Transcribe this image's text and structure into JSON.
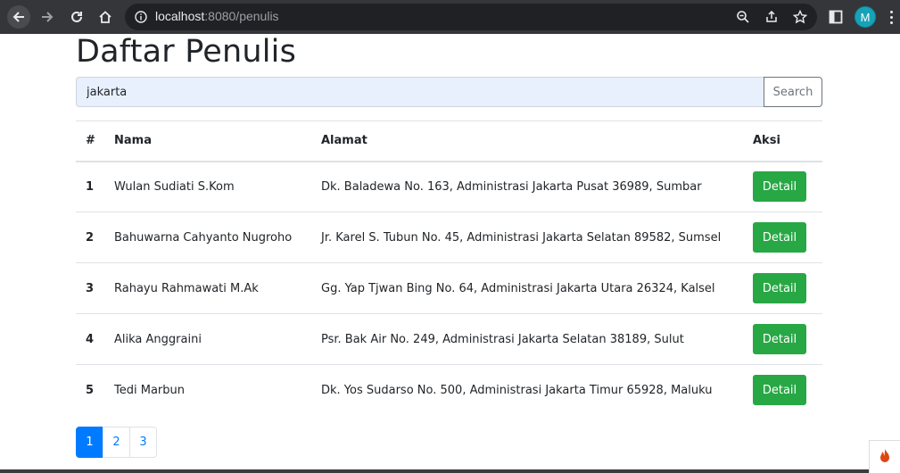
{
  "browser": {
    "url_host": "localhost",
    "url_rest": ":8080/penulis",
    "profile_initial": "M"
  },
  "page": {
    "title": "Daftar Penulis"
  },
  "search": {
    "value": "jakarta",
    "button_label": "Search"
  },
  "table": {
    "headers": [
      "#",
      "Nama",
      "Alamat",
      "Aksi"
    ],
    "rows": [
      {
        "no": "1",
        "nama": "Wulan Sudiati S.Kom",
        "alamat": "Dk. Baladewa No. 163, Administrasi Jakarta Pusat 36989, Sumbar",
        "aksi": "Detail"
      },
      {
        "no": "2",
        "nama": "Bahuwarna Cahyanto Nugroho",
        "alamat": "Jr. Karel S. Tubun No. 45, Administrasi Jakarta Selatan 89582, Sumsel",
        "aksi": "Detail"
      },
      {
        "no": "3",
        "nama": "Rahayu Rahmawati M.Ak",
        "alamat": "Gg. Yap Tjwan Bing No. 64, Administrasi Jakarta Utara 26324, Kalsel",
        "aksi": "Detail"
      },
      {
        "no": "4",
        "nama": "Alika Anggraini",
        "alamat": "Psr. Bak Air No. 249, Administrasi Jakarta Selatan 38189, Sulut",
        "aksi": "Detail"
      },
      {
        "no": "5",
        "nama": "Tedi Marbun",
        "alamat": "Dk. Yos Sudarso No. 500, Administrasi Jakarta Timur 65928, Maluku",
        "aksi": "Detail"
      }
    ]
  },
  "pagination": {
    "pages": [
      "1",
      "2",
      "3"
    ],
    "active": "1"
  },
  "colors": {
    "primary": "#007bff",
    "success": "#28a745",
    "chrome_bg": "#35363a"
  }
}
